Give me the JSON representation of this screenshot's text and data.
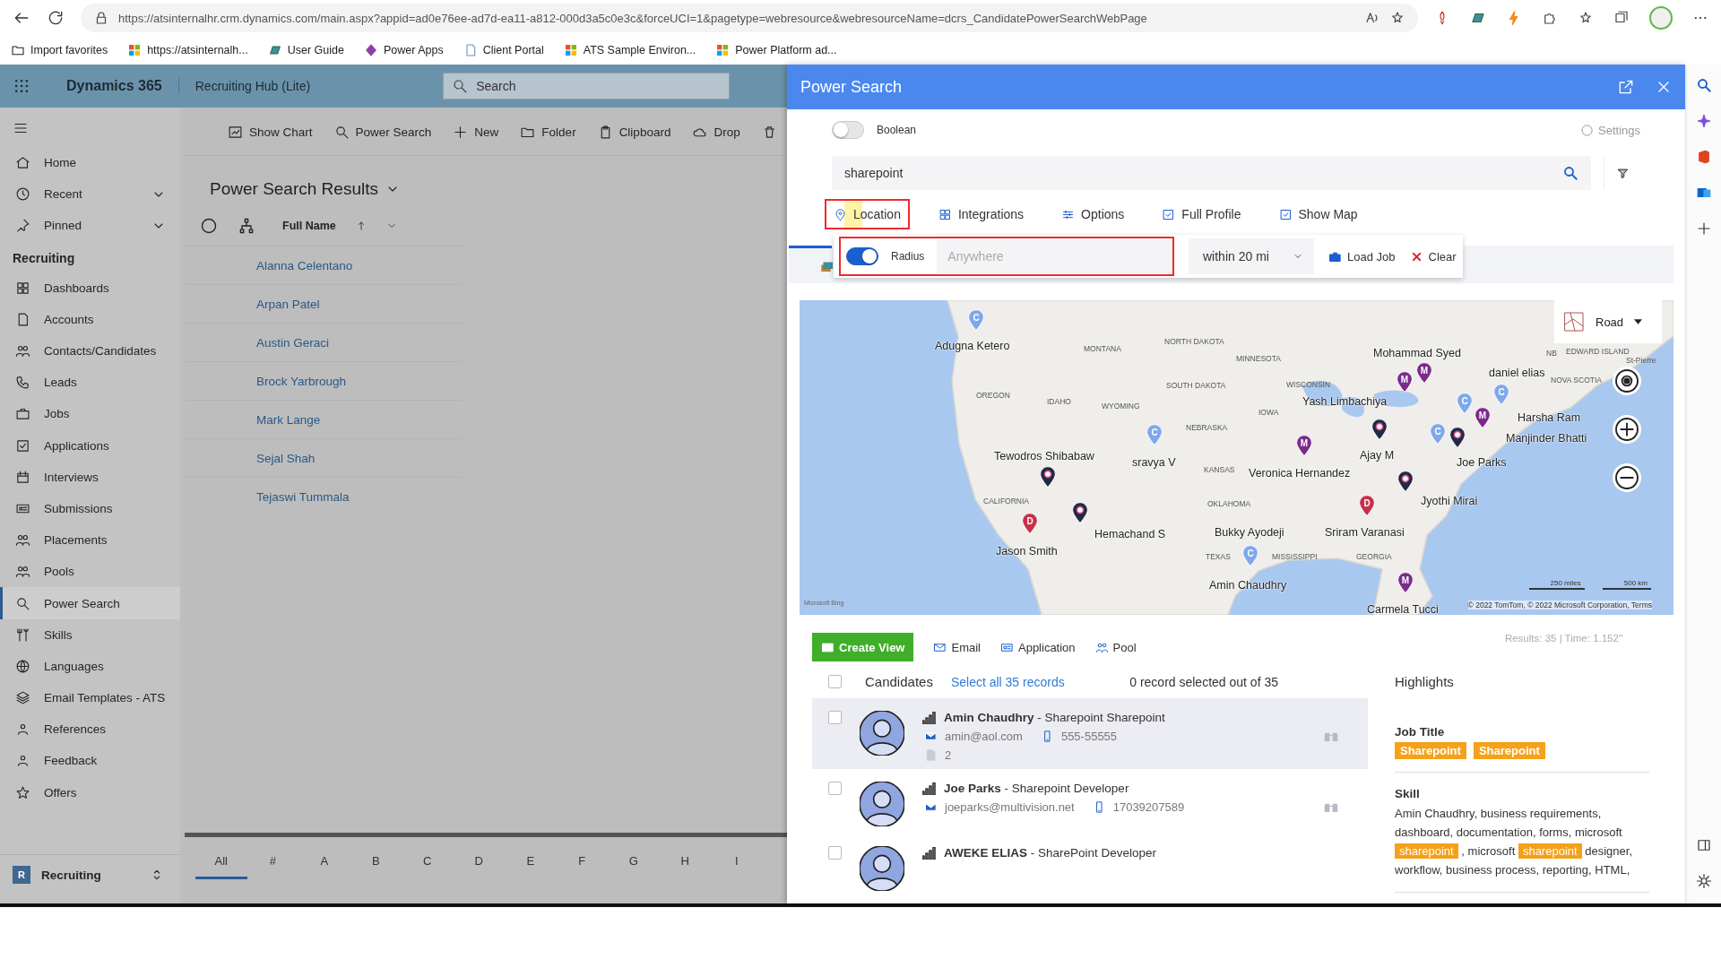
{
  "browser": {
    "url": "https://atsinternalhr.crm.dynamics.com/main.aspx?appid=ad0e76ee-ad7d-ea11-a812-000d3a5c0e3c&forceUCI=1&pagetype=webresource&webresourceName=dcrs_CandidatePowerSearchWebPage",
    "bookmarks": [
      "Import favorites",
      "https://atsinternalh...",
      "User Guide",
      "Power Apps",
      "Client Portal",
      "ATS Sample Environ...",
      "Power Platform ad..."
    ]
  },
  "app_header": {
    "product": "Dynamics 365",
    "app": "Recruiting Hub (Lite)",
    "search_placeholder": "Search"
  },
  "sidebar": {
    "top_items": [
      {
        "label": "Home"
      },
      {
        "label": "Recent",
        "expanded": false
      },
      {
        "label": "Pinned",
        "expanded": false
      }
    ],
    "section": "Recruiting",
    "items": [
      {
        "label": "Dashboards",
        "selected": false
      },
      {
        "label": "Accounts",
        "selected": false
      },
      {
        "label": "Contacts/Candidates",
        "selected": false
      },
      {
        "label": "Leads",
        "selected": false
      },
      {
        "label": "Jobs",
        "selected": false
      },
      {
        "label": "Applications",
        "selected": false
      },
      {
        "label": "Interviews",
        "selected": false
      },
      {
        "label": "Submissions",
        "selected": false
      },
      {
        "label": "Placements",
        "selected": false
      },
      {
        "label": "Pools",
        "selected": false
      },
      {
        "label": "Power Search",
        "selected": true
      },
      {
        "label": "Skills",
        "selected": false
      },
      {
        "label": "Languages",
        "selected": false
      },
      {
        "label": "Email Templates - ATS",
        "selected": false
      },
      {
        "label": "References",
        "selected": false
      },
      {
        "label": "Feedback",
        "selected": false
      },
      {
        "label": "Offers",
        "selected": false
      }
    ],
    "area": {
      "badge": "R",
      "label": "Recruiting"
    }
  },
  "command_bar": [
    "Show Chart",
    "Power Search",
    "New",
    "Folder",
    "Clipboard",
    "Drop"
  ],
  "view": {
    "title": "Power Search Results",
    "column": "Full Name",
    "rows": [
      "Alanna Celentano",
      "Arpan Patel",
      "Austin Geraci",
      "Brock Yarbrough",
      "Mark Lange",
      "Sejal Shah",
      "Tejaswi Tummala"
    ]
  },
  "alphabet": [
    {
      "label": "All",
      "selected": true
    },
    {
      "label": "#",
      "selected": false
    },
    {
      "label": "A",
      "selected": false
    },
    {
      "label": "B",
      "selected": false
    },
    {
      "label": "C",
      "selected": false
    },
    {
      "label": "D",
      "selected": false
    },
    {
      "label": "E",
      "selected": false
    },
    {
      "label": "F",
      "selected": false
    },
    {
      "label": "G",
      "selected": false
    },
    {
      "label": "H",
      "selected": false
    },
    {
      "label": "I",
      "selected": false
    }
  ],
  "power_search": {
    "title": "Power Search",
    "boolean": {
      "label": "Boolean",
      "on": false
    },
    "settings": "Settings",
    "query": "sharepoint",
    "tabs": [
      {
        "label": "Location",
        "kind": "tab",
        "highlighted": true
      },
      {
        "label": "Integrations",
        "kind": "tab",
        "highlighted": false
      },
      {
        "label": "Options",
        "kind": "tab",
        "highlighted": false
      },
      {
        "label": "Full Profile",
        "kind": "check",
        "checked": true
      },
      {
        "label": "Show Map",
        "kind": "check",
        "checked": true
      }
    ],
    "location": {
      "radius": {
        "label": "Radius",
        "on": true
      },
      "placeholder": "Anywhere",
      "highlighted": true,
      "distance": "within 20 mi",
      "load_job": "Load Job",
      "clear": "Clear"
    },
    "map": {
      "style": "Road",
      "regions": [
        "MONTANA",
        "NORTH DAKOTA",
        "MINNESOTA",
        "SOUTH DAKOTA",
        "WISCONSIN",
        "OREGON",
        "IDAHO",
        "WYOMING",
        "IOWA",
        "NEBRASKA",
        "KANSAS",
        "CALIFORNIA",
        "OKLAHOMA",
        "TEXAS",
        "MISSISSIPPI",
        "GEORGIA",
        "NB",
        "EDWARD ISLAND",
        "NOVA SCOTIA",
        "St-Pierre"
      ],
      "markers": [
        {
          "kind": "letter",
          "letter": "C",
          "color": "#7fa7ea"
        },
        {
          "kind": "letter",
          "letter": "M",
          "color": "#7b2a8c"
        },
        {
          "kind": "letter",
          "letter": "M",
          "color": "#7b2a8c"
        },
        {
          "kind": "letter",
          "letter": "C",
          "color": "#7fa7ea"
        },
        {
          "kind": "logo",
          "color": "#1f2a44"
        },
        {
          "kind": "letter",
          "letter": "M",
          "color": "#7b2a8c"
        },
        {
          "kind": "letter",
          "letter": "C",
          "color": "#7fa7ea"
        },
        {
          "kind": "logo",
          "color": "#1f2a44"
        },
        {
          "kind": "letter",
          "letter": "C",
          "color": "#7fa7ea"
        },
        {
          "kind": "letter",
          "letter": "C",
          "color": "#7fa7ea"
        },
        {
          "kind": "letter",
          "letter": "M",
          "color": "#7b2a8c"
        },
        {
          "kind": "logo",
          "color": "#1f2a44"
        },
        {
          "kind": "logo",
          "color": "#1f2a44"
        },
        {
          "kind": "logo",
          "color": "#1f2a44"
        },
        {
          "kind": "letter",
          "letter": "D",
          "color": "#c8304a"
        },
        {
          "kind": "letter",
          "letter": "D",
          "color": "#c8304a"
        },
        {
          "kind": "letter",
          "letter": "C",
          "color": "#7fa7ea"
        },
        {
          "kind": "letter",
          "letter": "M",
          "color": "#7b2a8c"
        }
      ],
      "labels": [
        "Adugna Ketero",
        "Mohammad Syed",
        "daniel elias",
        "Yash Limbachiya",
        "Harsha Ram",
        "Manjinder Bhatti",
        "Tewodros Shibabaw",
        "sravya V",
        "Veronica Hernandez",
        "Ajay M",
        "Joe Parks",
        "Jyothi Mirai",
        "Hemachand S",
        "Jason Smith",
        "Bukky Ayodeji",
        "Sriram Varanasi",
        "Amin Chaudhry",
        "Carmela Tucci"
      ],
      "scale": [
        "250 miles",
        "500 km"
      ],
      "attribution": "Microsoft Bing",
      "copyright": "© 2022 TomTom, © 2022 Microsoft Corporation, Terms"
    },
    "actions": [
      "Create View",
      "Email",
      "Application",
      "Pool"
    ],
    "stats": "Results: 35 | Time: 1.152\"",
    "list_header": {
      "checked": false,
      "title": "Candidates",
      "select_all": "Select all 35 records",
      "selection": "0 record selected out of 35",
      "highlights": "Highlights"
    },
    "candidates": [
      {
        "name": "Amin Chaudhry",
        "title": " - Sharepoint Sharepoint",
        "email": "amin@aol.com",
        "phone": "555-55555",
        "documents": "2",
        "checked": false,
        "hovered": true
      },
      {
        "name": "Joe Parks",
        "title": " - Sharepoint Developer",
        "email": "joeparks@multivision.net",
        "phone": "17039207589",
        "checked": false,
        "hovered": false
      },
      {
        "name": "AWEKE ELIAS",
        "title": " - SharePoint Developer",
        "checked": false,
        "hovered": false
      }
    ],
    "highlights": [
      {
        "label": "Job Title",
        "kind": "tags",
        "tags": [
          "Sharepoint",
          "Sharepoint"
        ]
      },
      {
        "label": "Skill",
        "kind": "text",
        "segments": [
          {
            "text": "Amin Chaudhry, business requirements, dashboard, documentation, forms, microsoft ",
            "highlight": false
          },
          {
            "text": "sharepoint",
            "highlight": true
          },
          {
            "text": " , microsoft ",
            "highlight": false
          },
          {
            "text": "sharepoint",
            "highlight": true
          },
          {
            "text": " designer, workflow, business process, reporting, HTML,",
            "highlight": false
          }
        ]
      }
    ]
  }
}
